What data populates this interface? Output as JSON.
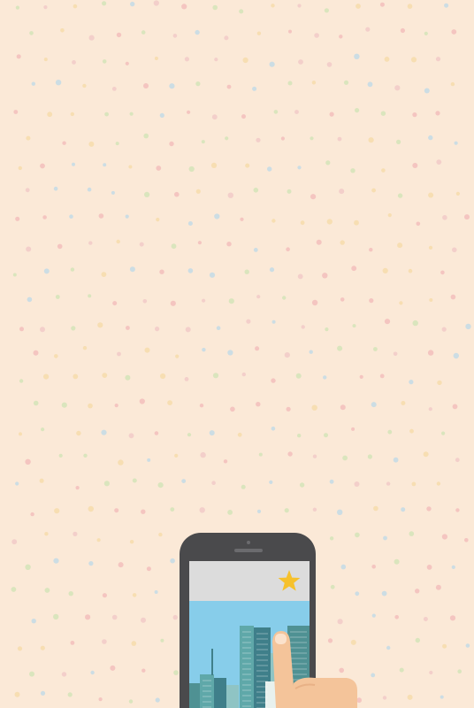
{
  "background": {
    "color": "#fbe9d7",
    "pattern": "confetti-dots",
    "dot_colors": [
      "#f2b8b8",
      "#cfe3b4",
      "#bcd8e8",
      "#f6d9a6",
      "#f0c6c6"
    ]
  },
  "phone": {
    "icon": "smartphone-icon",
    "body_color": "#4a4a4c",
    "app_header_color": "#dcdcdc",
    "screen_sky_color": "#87cdea",
    "favorite": {
      "icon": "star-icon",
      "color": "#f6c12c"
    },
    "city": {
      "icon": "city-skyline-icon",
      "colors": [
        "#5fa8a9",
        "#4f9193",
        "#3f7f8a",
        "#8fc4c4",
        "#2f6b73"
      ]
    }
  },
  "hand": {
    "icon": "pointing-hand-icon",
    "skin_color": "#f4c49a",
    "nail_color": "#fbe2cc"
  }
}
